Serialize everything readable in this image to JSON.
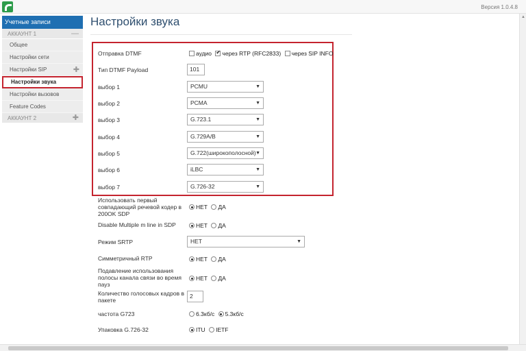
{
  "app": {
    "version": "Версия 1.0.4.8"
  },
  "sidebar": {
    "header": "Учетные записи",
    "account1": "АККАУНТ 1",
    "account1_ctrl": "—",
    "items": [
      {
        "label": "Общее"
      },
      {
        "label": "Настройки сети"
      },
      {
        "label": "Настройки SIP"
      },
      {
        "label": "Настройки звука"
      },
      {
        "label": "Настройки вызовов"
      },
      {
        "label": "Feature Codes"
      }
    ],
    "account2": "АККАУНТ 2",
    "plus": "✚"
  },
  "page": {
    "title": "Настройки звука"
  },
  "dtmf": {
    "label": "Отправка DTMF",
    "opt_audio": "аудио",
    "opt_rtp": "через RTP (RFC2833)",
    "opt_sip": "через SIP INFO",
    "audio_checked": false,
    "rtp_checked": true,
    "sip_checked": false
  },
  "payload": {
    "label": "Тип DTMF Payload",
    "value": "101"
  },
  "codecs": [
    {
      "label": "выбор 1",
      "value": "PCMU"
    },
    {
      "label": "выбор 2",
      "value": "PCMA"
    },
    {
      "label": "выбор 3",
      "value": "G.723.1"
    },
    {
      "label": "выбор 4",
      "value": "G.729A/B"
    },
    {
      "label": "выбор 5",
      "value": "G.722(широкополосной)"
    },
    {
      "label": "выбор 6",
      "value": "iLBC"
    },
    {
      "label": "выбор 7",
      "value": "G.726-32"
    }
  ],
  "first_codec": {
    "label_line1": "Использовать первый",
    "label_line2": "совпадающий речевой кодер в",
    "label_line3": "200OK SDP",
    "opt_no": "НЕТ",
    "opt_yes": "ДА",
    "selected": "НЕТ"
  },
  "multiple_m": {
    "label": "Disable Multiple m line in SDP",
    "opt_no": "НЕТ",
    "opt_yes": "ДА",
    "selected": "НЕТ"
  },
  "srtp": {
    "label": "Режим SRTP",
    "value": "НЕТ"
  },
  "sym_rtp": {
    "label": "Симметричный RTP",
    "opt_no": "НЕТ",
    "opt_yes": "ДА",
    "selected": "НЕТ"
  },
  "silence": {
    "label_line1": "Подавление использования",
    "label_line2": "полосы канала связи во время",
    "label_line3": "пауз",
    "opt_no": "НЕТ",
    "opt_yes": "ДА",
    "selected": "НЕТ"
  },
  "frames": {
    "label_line1": "Количество голосовых кадров в",
    "label_line2": "пакете",
    "value": "2"
  },
  "g723": {
    "label": "частота G723",
    "opt_a": "6.3кб/с",
    "opt_b": "5.3кб/с",
    "selected": "5.3кб/с"
  },
  "g726": {
    "label": "Упаковка G.726-32",
    "opt_a": "ITU",
    "opt_b": "IETF",
    "selected": "ITU"
  },
  "icons": {
    "dropdown": "▼",
    "scroll_up": "▲"
  },
  "colors": {
    "accent": "#1f6fb2",
    "highlight": "#c4232e"
  }
}
